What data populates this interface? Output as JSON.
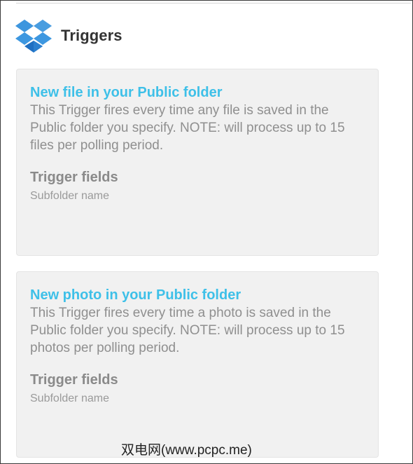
{
  "header": {
    "title": "Triggers",
    "logo_icon": "dropbox-logo-icon"
  },
  "triggers": [
    {
      "title": "New file in your Public folder",
      "description": "This Trigger fires every time any file is saved in the Public folder you specify. NOTE: will process up to 15 files per polling period.",
      "fields_heading": "Trigger fields",
      "fields": [
        "Subfolder name"
      ]
    },
    {
      "title": "New photo in your Public folder",
      "description": "This Trigger fires every time a photo is saved in the Public folder you specify. NOTE: will process up to 15 photos per polling period.",
      "fields_heading": "Trigger fields",
      "fields": [
        "Subfolder name"
      ]
    }
  ],
  "watermark": "双电网(www.pcpc.me)",
  "colors": {
    "accent": "#3ec0e8",
    "brand_blue": "#2c7fd4",
    "card_bg": "#f1f1f1",
    "muted_text": "#8f8f8f"
  }
}
